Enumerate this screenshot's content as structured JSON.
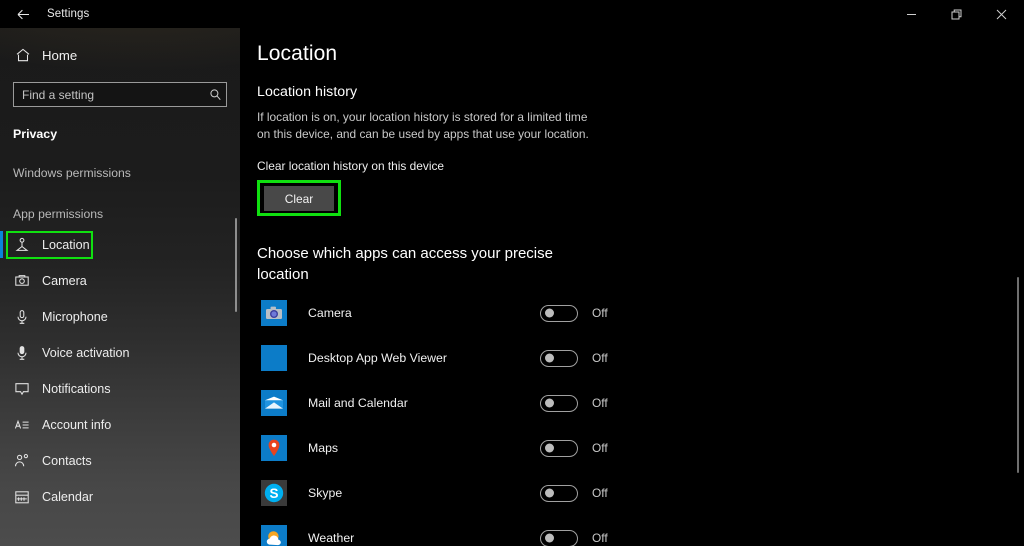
{
  "window": {
    "title": "Settings",
    "back_icon": "back-arrow-icon",
    "controls": {
      "minimize": "minimize-icon",
      "maximize": "restore-icon",
      "close": "close-icon"
    }
  },
  "sidebar": {
    "home": {
      "label": "Home",
      "icon": "home-icon"
    },
    "search": {
      "placeholder": "Find a setting",
      "value": "",
      "icon": "search-icon"
    },
    "section_title": "Privacy",
    "groups": [
      {
        "label": "Windows permissions"
      },
      {
        "label": "App permissions"
      }
    ],
    "items": [
      {
        "label": "Location",
        "icon": "location-person-icon",
        "selected": true,
        "highlighted": true
      },
      {
        "label": "Camera",
        "icon": "camera-icon",
        "selected": false,
        "highlighted": false
      },
      {
        "label": "Microphone",
        "icon": "microphone-icon",
        "selected": false,
        "highlighted": false
      },
      {
        "label": "Voice activation",
        "icon": "voice-activation-icon",
        "selected": false,
        "highlighted": false
      },
      {
        "label": "Notifications",
        "icon": "notification-bubble-icon",
        "selected": false,
        "highlighted": false
      },
      {
        "label": "Account info",
        "icon": "account-info-icon",
        "selected": false,
        "highlighted": false
      },
      {
        "label": "Contacts",
        "icon": "contacts-icon",
        "selected": false,
        "highlighted": false
      },
      {
        "label": "Calendar",
        "icon": "calendar-icon",
        "selected": false,
        "highlighted": false
      }
    ],
    "accent_color": "#0a84d8",
    "highlight_color": "#10e010"
  },
  "main": {
    "page_title": "Location",
    "history": {
      "heading": "Location history",
      "description": "If location is on, your location history is stored for a limited time on this device, and can be used by apps that use your location.",
      "clear_label": "Clear location history on this device",
      "clear_button": "Clear",
      "clear_button_highlighted": true
    },
    "apps_section": {
      "heading": "Choose which apps can access your precise location",
      "apps": [
        {
          "name": "Camera",
          "icon": "camera-app-icon",
          "state": "Off",
          "on": false
        },
        {
          "name": "Desktop App Web Viewer",
          "icon": "desktop-app-web-viewer-icon",
          "state": "Off",
          "on": false
        },
        {
          "name": "Mail and Calendar",
          "icon": "mail-calendar-icon",
          "state": "Off",
          "on": false
        },
        {
          "name": "Maps",
          "icon": "maps-icon",
          "state": "Off",
          "on": false
        },
        {
          "name": "Skype",
          "icon": "skype-icon",
          "state": "Off",
          "on": false
        },
        {
          "name": "Weather",
          "icon": "weather-icon",
          "state": "Off",
          "on": false
        }
      ]
    }
  }
}
